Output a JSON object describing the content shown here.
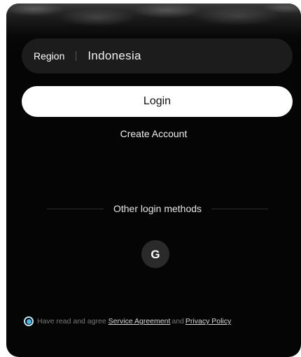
{
  "region": {
    "label": "Region",
    "value": "Indonesia"
  },
  "actions": {
    "login_label": "Login",
    "create_account_label": "Create Account"
  },
  "other_methods": {
    "label": "Other login methods",
    "providers": [
      {
        "name": "Google",
        "glyph": "G",
        "icon": "google-icon"
      }
    ]
  },
  "agreement": {
    "prefix": "Have read and agree",
    "service_link": "Service Agreement",
    "conjunction": "and",
    "privacy_link": "Privacy Policy",
    "checked": true
  },
  "colors": {
    "card_background": "#050505",
    "field_background": "#1c1c1c",
    "primary_button": "#ffffff",
    "radio_accent": "#4fb6e3"
  }
}
